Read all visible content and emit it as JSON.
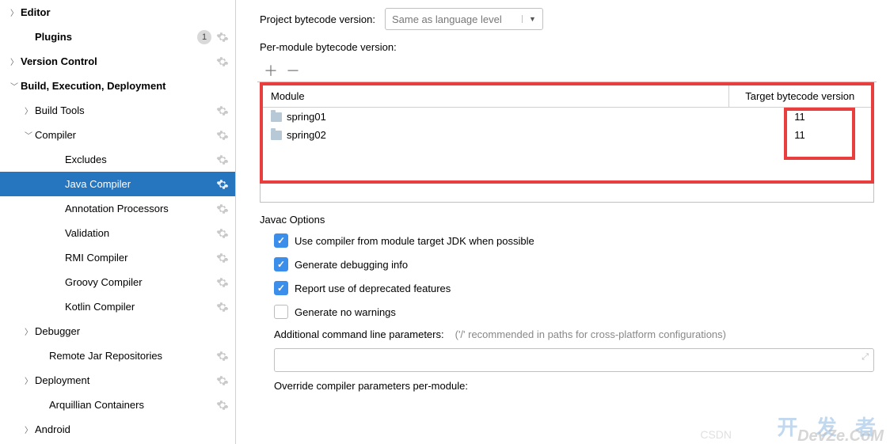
{
  "sidebar": {
    "items": [
      {
        "label": "Editor",
        "bold": true,
        "chev": "right",
        "pad": 0,
        "gear": false
      },
      {
        "label": "Plugins",
        "bold": true,
        "chev": "",
        "pad": 1,
        "badge": "1",
        "gear": true
      },
      {
        "label": "Version Control",
        "bold": true,
        "chev": "right",
        "pad": 0,
        "gear": true
      },
      {
        "label": "Build, Execution, Deployment",
        "bold": true,
        "chev": "down",
        "pad": 0,
        "gear": false
      },
      {
        "label": "Build Tools",
        "bold": false,
        "chev": "right",
        "pad": 1,
        "gear": true
      },
      {
        "label": "Compiler",
        "bold": false,
        "chev": "down",
        "pad": 1,
        "gear": true
      },
      {
        "label": "Excludes",
        "bold": false,
        "chev": "",
        "pad": 3,
        "gear": true
      },
      {
        "label": "Java Compiler",
        "bold": false,
        "chev": "",
        "pad": 3,
        "gear": true,
        "selected": true
      },
      {
        "label": "Annotation Processors",
        "bold": false,
        "chev": "",
        "pad": 3,
        "gear": true
      },
      {
        "label": "Validation",
        "bold": false,
        "chev": "",
        "pad": 3,
        "gear": true
      },
      {
        "label": "RMI Compiler",
        "bold": false,
        "chev": "",
        "pad": 3,
        "gear": true
      },
      {
        "label": "Groovy Compiler",
        "bold": false,
        "chev": "",
        "pad": 3,
        "gear": true
      },
      {
        "label": "Kotlin Compiler",
        "bold": false,
        "chev": "",
        "pad": 3,
        "gear": true
      },
      {
        "label": "Debugger",
        "bold": false,
        "chev": "right",
        "pad": 1,
        "gear": false
      },
      {
        "label": "Remote Jar Repositories",
        "bold": false,
        "chev": "",
        "pad": 2,
        "gear": true
      },
      {
        "label": "Deployment",
        "bold": false,
        "chev": "right",
        "pad": 1,
        "gear": true
      },
      {
        "label": "Arquillian Containers",
        "bold": false,
        "chev": "",
        "pad": 2,
        "gear": true
      },
      {
        "label": "Android",
        "bold": false,
        "chev": "right",
        "pad": 1,
        "gear": false
      }
    ]
  },
  "main": {
    "bytecode_label": "Project bytecode version:",
    "bytecode_value": "Same as language level",
    "permodule_label": "Per-module bytecode version:",
    "table": {
      "col_module": "Module",
      "col_target": "Target bytecode version",
      "rows": [
        {
          "module": "spring01",
          "target": "11"
        },
        {
          "module": "spring02",
          "target": "11"
        }
      ]
    },
    "javac_label": "Javac Options",
    "opts": [
      {
        "label": "Use compiler from module target JDK when possible",
        "checked": true
      },
      {
        "label": "Generate debugging info",
        "checked": true
      },
      {
        "label": "Report use of deprecated features",
        "checked": true
      },
      {
        "label": "Generate no warnings",
        "checked": false
      }
    ],
    "addl_params_label": "Additional command line parameters:",
    "addl_hint": "('/' recommended in paths for cross-platform configurations)",
    "override_label": "Override compiler parameters per-module:"
  },
  "watermark": {
    "a": "开 发 者",
    "b": "DevZe.CoM",
    "c": "CSDN"
  }
}
